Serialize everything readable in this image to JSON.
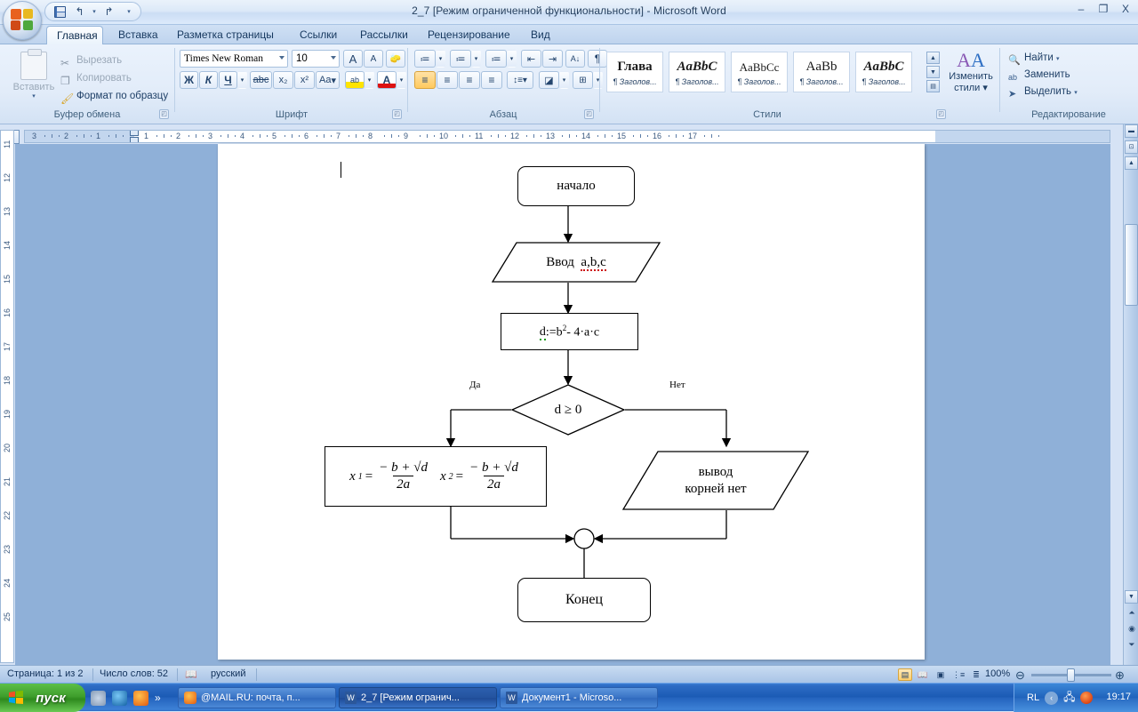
{
  "window": {
    "title": "2_7 [Режим ограниченной функциональности] - Microsoft Word",
    "minimize": "–",
    "maximize": "❐",
    "close": "X"
  },
  "quick_access": {
    "save": "save-icon",
    "undo": "↰",
    "undo_arrow": "▾",
    "redo": "↱",
    "customize": "▾"
  },
  "tabs": [
    {
      "label": "Главная",
      "active": true
    },
    {
      "label": "Вставка",
      "active": false
    },
    {
      "label": "Разметка страницы",
      "active": false
    },
    {
      "label": "Ссылки",
      "active": false
    },
    {
      "label": "Рассылки",
      "active": false
    },
    {
      "label": "Рецензирование",
      "active": false
    },
    {
      "label": "Вид",
      "active": false
    }
  ],
  "ribbon": {
    "clipboard": {
      "group_label": "Буфер обмена",
      "paste": "Вставить",
      "paste_arrow": "▾",
      "cut": "Вырезать",
      "copy": "Копировать",
      "format_painter": "Формат по образцу"
    },
    "font": {
      "group_label": "Шрифт",
      "font_name": "Times New Roman",
      "font_size": "10",
      "grow_font": "A",
      "shrink_font": "A",
      "clear_formatting": "Aa",
      "bold": "Ж",
      "italic": "К",
      "underline": "Ч",
      "strikethrough": "abc",
      "subscript": "x₂",
      "superscript": "x²",
      "change_case": "Aa",
      "highlight": "ab",
      "font_color": "A"
    },
    "paragraph": {
      "group_label": "Абзац",
      "bullets": "≔",
      "numbering": "≔",
      "multilevel": "≔",
      "decrease_indent": "⇤",
      "increase_indent": "⇥",
      "sort": "A↓",
      "show_marks": "¶",
      "align_left": "≡",
      "align_center": "≡",
      "align_right": "≡",
      "justify": "≡",
      "line_spacing": "↕≡",
      "shading": "◪",
      "borders": "⊞"
    },
    "styles": {
      "group_label": "Стили",
      "gallery": [
        {
          "preview": "Глава",
          "name": "¶ Заголов..."
        },
        {
          "preview": "AaBbC",
          "name": "¶ Заголов..."
        },
        {
          "preview": "AaBbCc",
          "name": "¶ Заголов..."
        },
        {
          "preview": "AaBb",
          "name": "¶ Заголов..."
        },
        {
          "preview": "AaBbC",
          "name": "¶ Заголов..."
        }
      ],
      "change_styles": "Изменить",
      "change_styles2": "стили ▾"
    },
    "editing": {
      "group_label": "Редактирование",
      "find": "Найти",
      "find_arrow": "▾",
      "replace": "Заменить",
      "select": "Выделить",
      "select_arrow": "▾"
    }
  },
  "ruler": {
    "corner_tab": "L",
    "horizontal_labels": [
      "3",
      "2",
      "1",
      "1",
      "2",
      "3",
      "4",
      "5",
      "6",
      "7",
      "8",
      "9",
      "10",
      "11",
      "12",
      "13",
      "14",
      "15",
      "16",
      "17"
    ],
    "vertical_labels": [
      "11",
      "12",
      "13",
      "14",
      "15",
      "16",
      "17",
      "18",
      "19",
      "20",
      "21",
      "22",
      "23",
      "24",
      "25"
    ]
  },
  "flowchart": {
    "start": "начало",
    "input": "Ввод",
    "input_vars": "a,b,c",
    "discriminant_lhs": "d",
    "discriminant_rhs": ":=b",
    "discriminant_exp": "2",
    "discriminant_tail": "- 4·a·c",
    "decision": "d ≥ 0",
    "branch_yes": "Да",
    "branch_no": "Нет",
    "roots": {
      "x1_label": "x",
      "x1_sub": "1",
      "x2_label": "x",
      "x2_sub": "2",
      "equals": "=",
      "numerator": "− b + √d",
      "denominator": "2a"
    },
    "output_line1": "вывод",
    "output_line2": "корней нет",
    "end": "Конец"
  },
  "status_bar": {
    "page": "Страница: 1 из 2",
    "words": "Число слов: 52",
    "language": "русский",
    "proofing_icon": "spellcheck-icon",
    "views": [
      "print-layout",
      "full-screen-reading",
      "web-layout",
      "outline",
      "draft"
    ],
    "zoom": "100%",
    "zoom_out": "−",
    "zoom_in": "+"
  },
  "taskbar": {
    "start": "пуск",
    "quick_launch": [
      "show-desktop-icon",
      "internet-explorer-icon",
      "firefox-icon"
    ],
    "quick_more": "»",
    "buttons": [
      {
        "label": "@MAIL.RU: почта, п...",
        "icon": "firefox-icon",
        "active": false
      },
      {
        "label": "2_7 [Режим огранич...",
        "icon": "word-icon",
        "active": true
      },
      {
        "label": "Документ1 - Microso...",
        "icon": "word-icon",
        "active": false
      }
    ],
    "tray": {
      "layout": "RL",
      "icons": [
        "back-icon",
        "network-icon",
        "opera-icon"
      ],
      "clock": "19:17"
    }
  }
}
